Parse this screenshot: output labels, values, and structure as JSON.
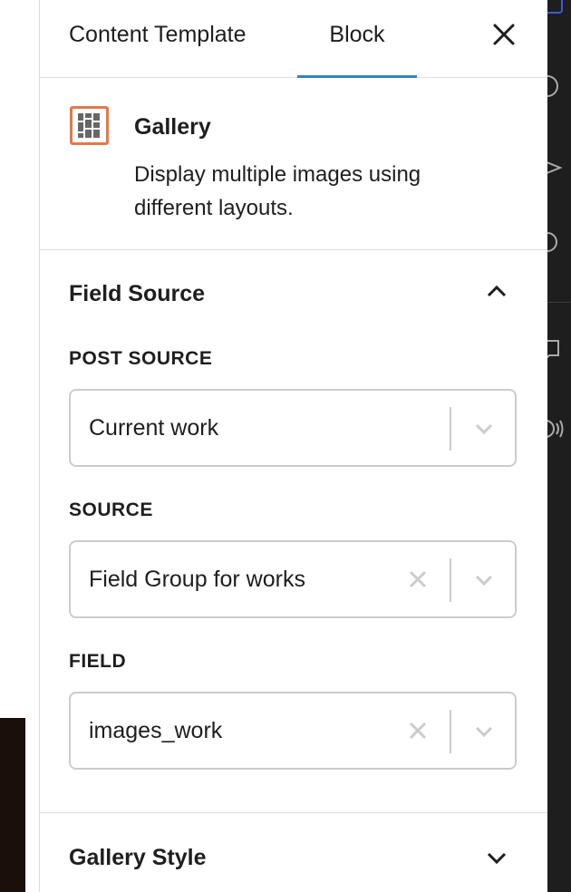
{
  "tabs": {
    "content_template": "Content Template",
    "block": "Block",
    "active": "Block"
  },
  "block": {
    "title": "Gallery",
    "description": "Display multiple images using different layouts.",
    "icon": "gallery-icon",
    "icon_color": "#e07a4b"
  },
  "field_source": {
    "title": "Field Source",
    "expanded": true,
    "post_source": {
      "label": "POST SOURCE",
      "value": "Current work"
    },
    "source": {
      "label": "SOURCE",
      "value": "Field Group for works"
    },
    "field": {
      "label": "FIELD",
      "value": "images_work"
    }
  },
  "gallery_style": {
    "title": "Gallery Style",
    "expanded": false
  },
  "colors": {
    "accent": "#3582c4",
    "border": "#cccccc"
  }
}
